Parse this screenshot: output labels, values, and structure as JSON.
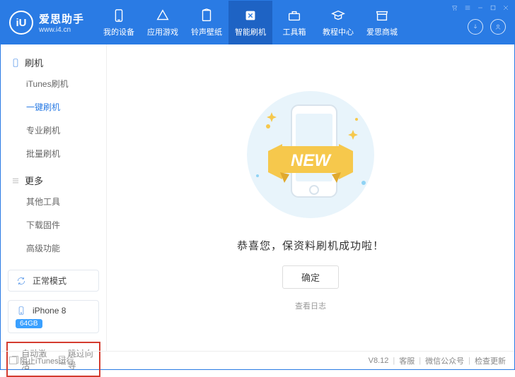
{
  "header": {
    "logo_text": "iU",
    "brand": "爱思助手",
    "site": "www.i4.cn",
    "navs": [
      {
        "label": "我的设备"
      },
      {
        "label": "应用游戏"
      },
      {
        "label": "铃声壁纸"
      },
      {
        "label": "智能刷机",
        "active": true
      },
      {
        "label": "工具箱"
      },
      {
        "label": "教程中心"
      },
      {
        "label": "爱思商城"
      }
    ]
  },
  "sidebar": {
    "groups": [
      {
        "header": "刷机",
        "icon": "phone",
        "items": [
          {
            "label": "iTunes刷机"
          },
          {
            "label": "一键刷机",
            "active": true
          },
          {
            "label": "专业刷机"
          },
          {
            "label": "批量刷机"
          }
        ]
      },
      {
        "header": "更多",
        "icon": "menu",
        "items": [
          {
            "label": "其他工具"
          },
          {
            "label": "下载固件"
          },
          {
            "label": "高级功能"
          }
        ]
      }
    ],
    "mode": "正常模式",
    "device_name": "iPhone 8",
    "device_badge": "64GB",
    "opts": {
      "auto_activate": "自动激活",
      "skip_guide": "跳过向导"
    }
  },
  "content": {
    "illus_banner": "NEW",
    "congrats": "恭喜您，保资料刷机成功啦！",
    "ok": "确定",
    "view_log": "查看日志"
  },
  "statusbar": {
    "block_itunes": "阻止iTunes运行",
    "version": "V8.12",
    "support": "客服",
    "wechat": "微信公众号",
    "update": "检查更新"
  }
}
